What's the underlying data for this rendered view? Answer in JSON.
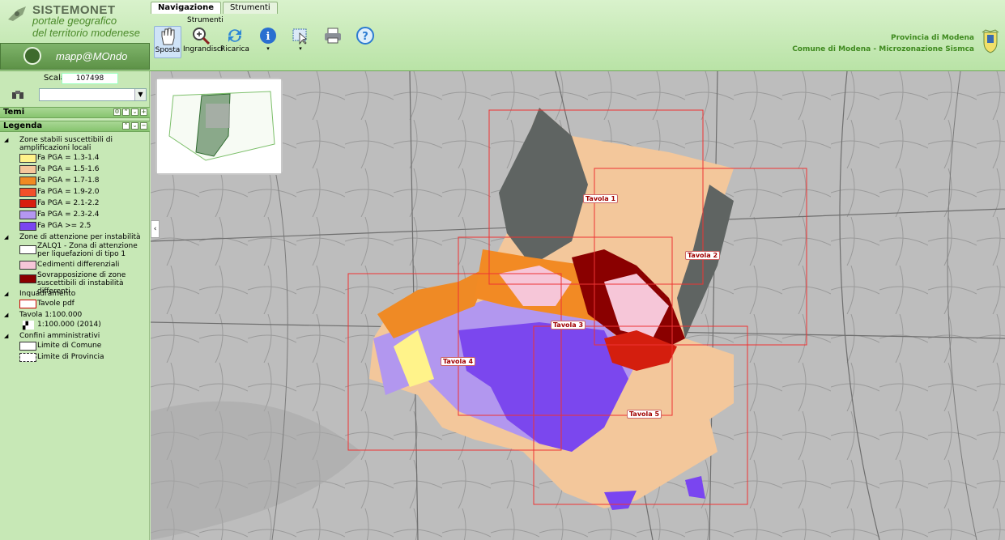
{
  "header": {
    "logo_title": "SISTEMONET",
    "logo_sub1": "portale geografico",
    "logo_sub2": "del territorio modenese",
    "mappa_label": "mapp@MOndo",
    "right_line1": "Provincia di Modena",
    "right_line2": "Comune di Modena - Microzonazione Sismca"
  },
  "tabs": [
    {
      "label": "Navigazione",
      "active": true
    },
    {
      "label": "Strumenti",
      "active": false
    }
  ],
  "toolbar": {
    "strumenti_label": "Strumenti",
    "sposta": "Sposta",
    "ingrandisci": "Ingrandisci",
    "ricarica": "Ricarica"
  },
  "left": {
    "scale_label": "Scala",
    "scale_value": "107498",
    "temi": "Temi",
    "legenda": "Legenda"
  },
  "legend": {
    "g1": "Zone stabili suscettibili di amplificazioni locali",
    "g1_items": [
      {
        "label": "Fa PGA = 1.3-1.4",
        "color": "#fff38a"
      },
      {
        "label": "Fa PGA = 1.5-1.6",
        "color": "#f5c79a"
      },
      {
        "label": "Fa PGA = 1.7-1.8",
        "color": "#f08a22"
      },
      {
        "label": "Fa PGA = 1.9-2.0",
        "color": "#f2502a"
      },
      {
        "label": "Fa PGA = 2.1-2.2",
        "color": "#d81e0e"
      },
      {
        "label": "Fa PGA = 2.3-2.4",
        "color": "#b497f0"
      },
      {
        "label": "Fa PGA >= 2.5",
        "color": "#7a45f0"
      }
    ],
    "g2": "Zone di attenzione per instabilità",
    "g2_items": [
      {
        "label": "ZALQ1 - Zona di attenzione per liquefazioni di tipo 1",
        "color": "#ffffff"
      },
      {
        "label": "Cedimenti differenziali",
        "color": "#f6c6d8"
      },
      {
        "label": "Sovrapposizione di zone suscettibili di instabilità differenti",
        "color": "#8a0000"
      }
    ],
    "g3": "Inquadramento",
    "g3_item": "Tavole pdf",
    "g4": "Tavola 1:100.000",
    "g4_item": "1:100.000 (2014)",
    "g5": "Confini amministrativi",
    "g5_items": [
      "Limite di Comune",
      "Limite di Provincia"
    ]
  },
  "map": {
    "tavole": [
      "Tavola 1",
      "Tavola 2",
      "Tavola 3",
      "Tavola 4",
      "Tavola 5"
    ]
  }
}
